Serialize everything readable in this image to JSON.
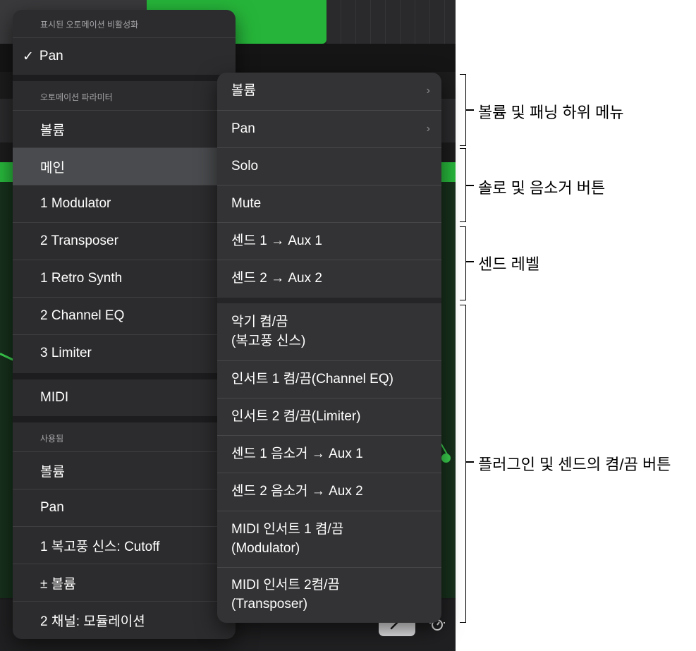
{
  "main_menu": {
    "header_top": "표시된 오토메이션 비활성화",
    "pan_checked": "Pan",
    "check_mark": "✓",
    "section_params": "오토메이션 파라미터",
    "items": [
      "볼륨",
      "메인",
      "1 Modulator",
      "2 Transposer",
      "1 Retro Synth",
      "2 Channel EQ",
      "3 Limiter"
    ],
    "selected_item": "메인",
    "midi": "MIDI",
    "section_used": "사용됨",
    "used_items": [
      "볼륨",
      "Pan",
      "1 복고풍 신스: Cutoff",
      "± 볼륨",
      "2 채널: 모듈레이션"
    ]
  },
  "sub_menu": {
    "volume": "볼륨",
    "pan": "Pan",
    "solo": "Solo",
    "mute": "Mute",
    "send1": "센드 1 → Aux 1",
    "send2": "센드 2 → Aux 2",
    "instrument_onoff_line1": "악기 켬/끔",
    "instrument_onoff_line2": "(복고풍 신스)",
    "insert1": "인서트 1 켬/끔(Channel EQ)",
    "insert2": "인서트 2 켬/끔(Limiter)",
    "send1_mute": "센드 1 음소거 → Aux 1",
    "send2_mute": "센드 2 음소거 → Aux 2",
    "midi_insert1_line1": "MIDI 인서트 1 켬/끔",
    "midi_insert1_line2": "(Modulator)",
    "midi_insert2_line1": "MIDI 인서트 2켬/끔",
    "midi_insert2_line2": "(Transposer)",
    "chevron": "›"
  },
  "callouts": {
    "volume_pan": "볼륨 및 패닝 하위 메뉴",
    "solo_mute": "솔로 및 음소거 버튼",
    "send_level": "센드 레벨",
    "plugin_onoff": "플러그인 및 센드의 켬/끔 버튼"
  },
  "colors": {
    "menu_bg": "#2c2c2e",
    "submenu_bg": "#333335",
    "selected_bg": "#4a4b4e",
    "region_green": "#26b53a"
  },
  "icons": [
    "checkmark-icon",
    "chevron-right-icon",
    "pencil-icon",
    "automation-icon"
  ]
}
